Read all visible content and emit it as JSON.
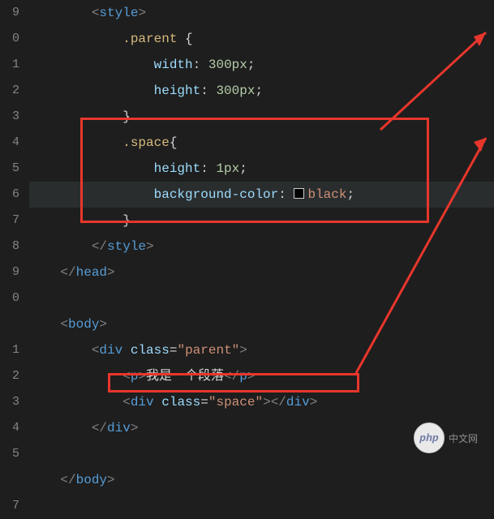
{
  "gutter": [
    "9",
    "0",
    "1",
    "2",
    "3",
    "4",
    "5",
    "6",
    "7",
    "8",
    "9",
    "0",
    "",
    "1",
    "2",
    "3",
    "4",
    "5",
    "",
    "7"
  ],
  "code": {
    "l0_style_open": "<style>",
    "l1_sel": ".parent {",
    "l2_prop": "width",
    "l2_val": "300px",
    "l3_prop": "height",
    "l3_val": "300px",
    "l4_brace": "}",
    "l5_sel": ".space",
    "l5_brace": "{",
    "l6_prop": "height",
    "l6_val": "1px",
    "l7_prop": "background-color",
    "l7_val": "black",
    "l8_brace": "}",
    "l9_style_close": "</style>",
    "l10_head_close": "</head>",
    "l12_body_open": "<body>",
    "l13_tag": "div",
    "l13_attr": "class",
    "l13_val": "\"parent\"",
    "l14_tag": "p",
    "l14_text": "我是一个段落",
    "l15_tag": "div",
    "l15_attr": "class",
    "l15_val": "\"space\"",
    "l16_div_close": "</div>",
    "l18_body_close": "</body>"
  },
  "watermark": {
    "logo": "php",
    "text": "中文网"
  }
}
